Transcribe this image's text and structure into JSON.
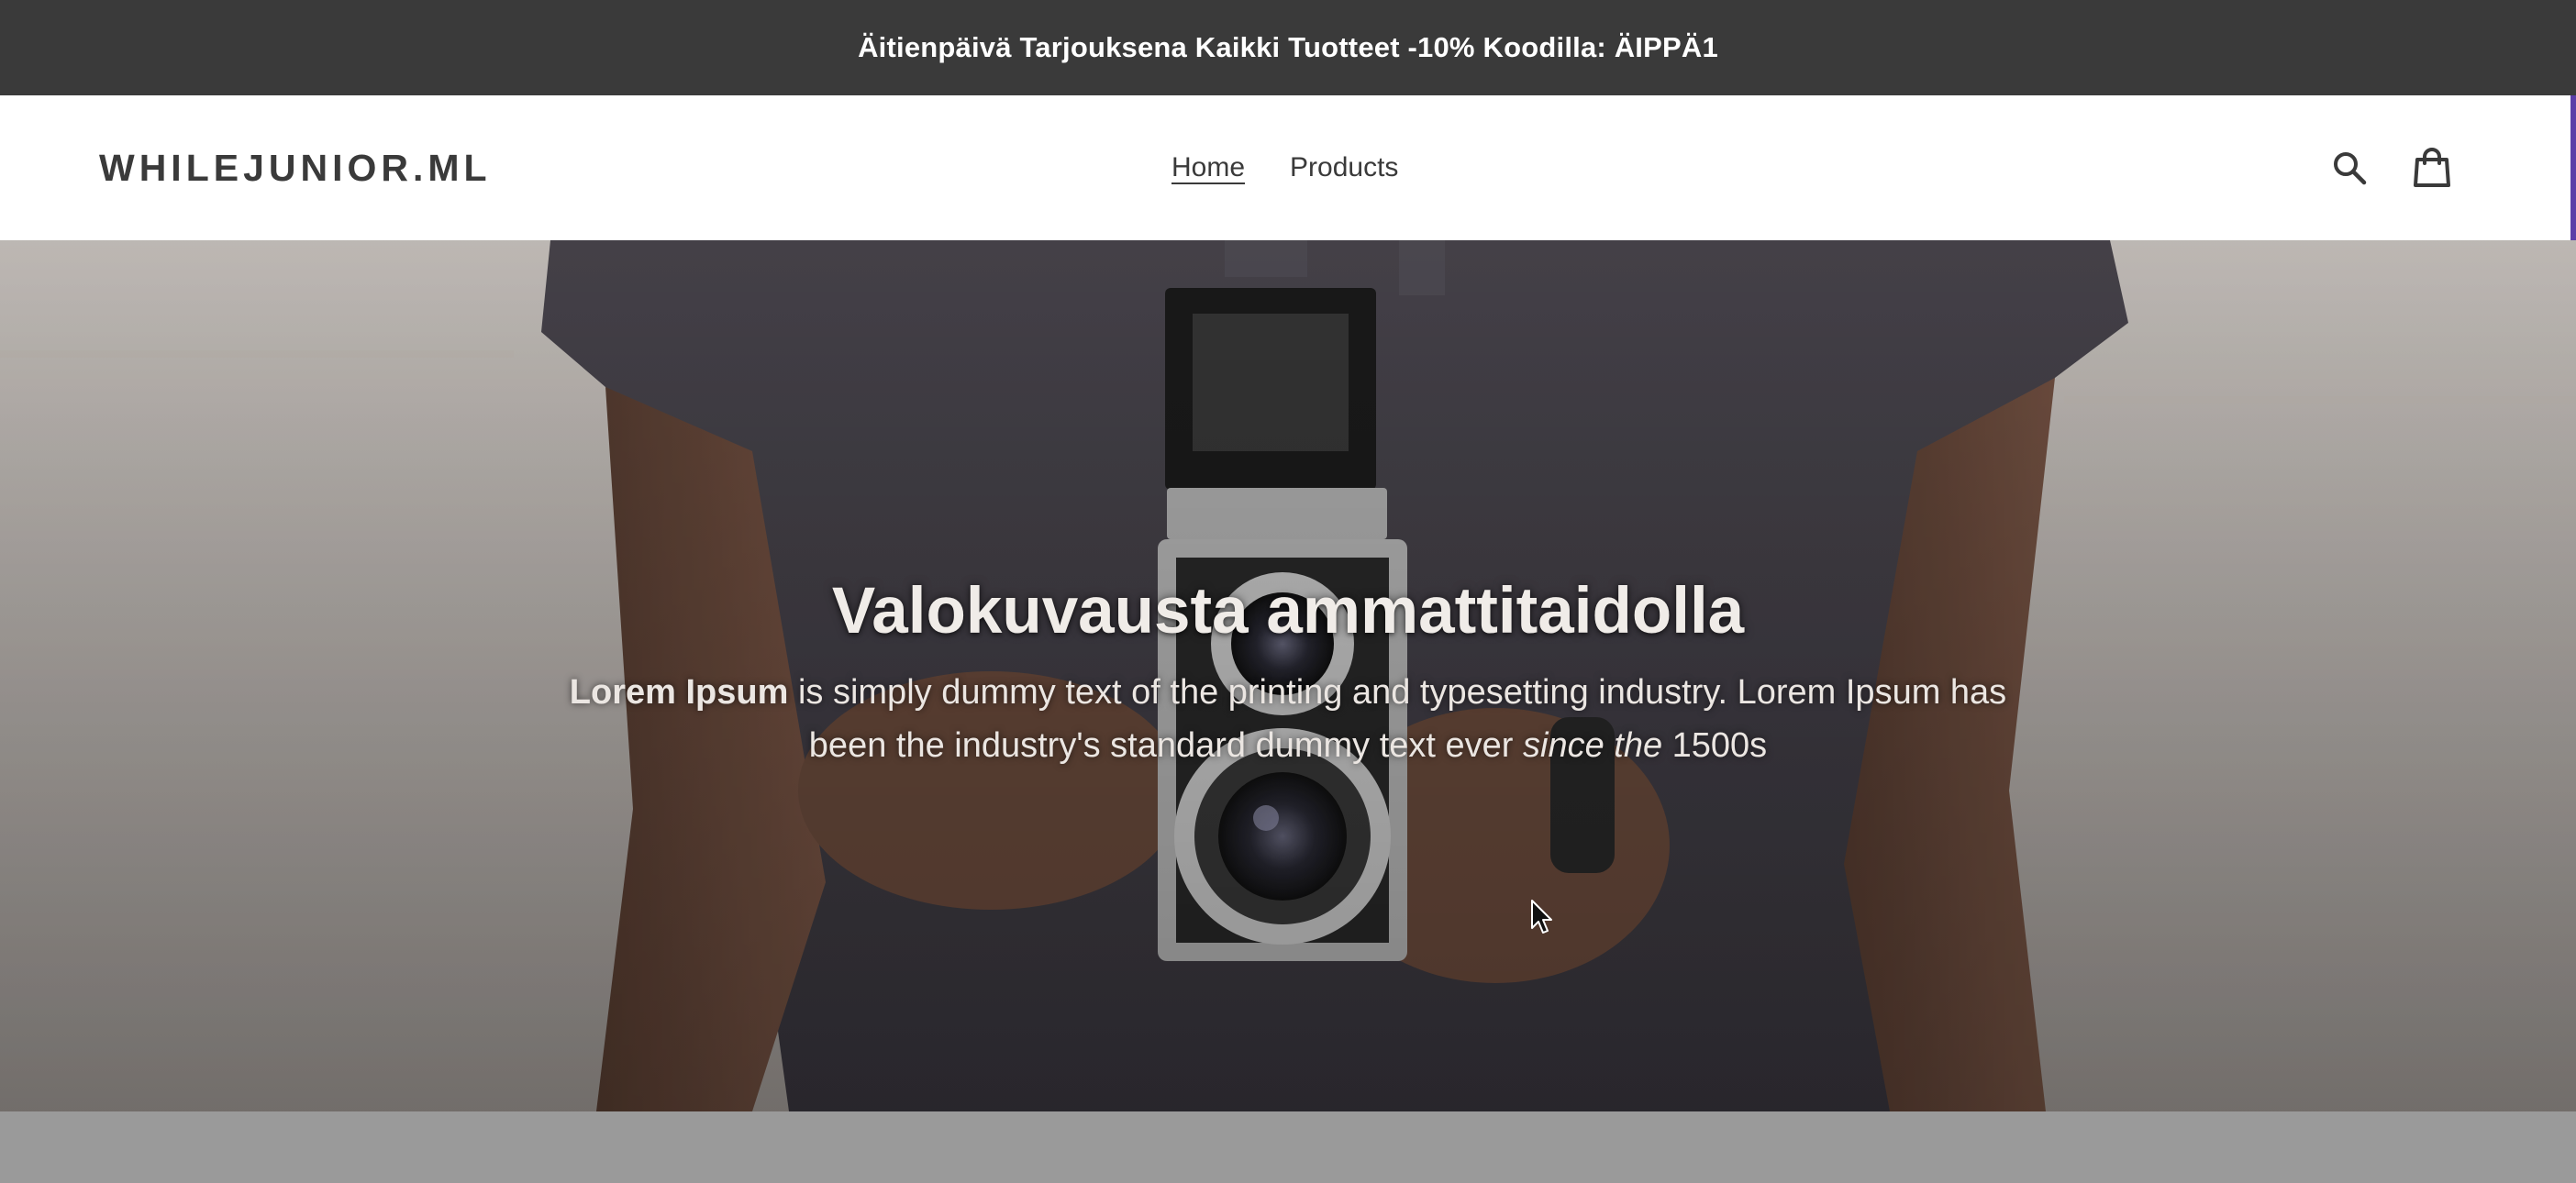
{
  "announcement": {
    "text": "Äitienpäivä Tarjouksena Kaikki Tuotteet -10% Koodilla: ÄIPPÄ1"
  },
  "header": {
    "logo": "WHILEJUNIOR.ML",
    "nav": [
      {
        "label": "Home",
        "active": true
      },
      {
        "label": "Products",
        "active": false
      }
    ],
    "icons": [
      "search-icon",
      "cart-icon"
    ]
  },
  "hero": {
    "title": "Valokuvausta ammattitaidolla",
    "text_bold": "Lorem Ipsum",
    "text_1": " is simply dummy text of the printing and typesetting industry. Lorem Ipsum has been the industry's standard dummy text ever ",
    "text_italic": "since the",
    "text_2": " 1500s"
  },
  "colors": {
    "announcement_bg": "#3a3a3a",
    "text_dark": "#3a3a3a",
    "hero_text": "#f0ece8",
    "bottom_band": "#9a9a9a"
  }
}
